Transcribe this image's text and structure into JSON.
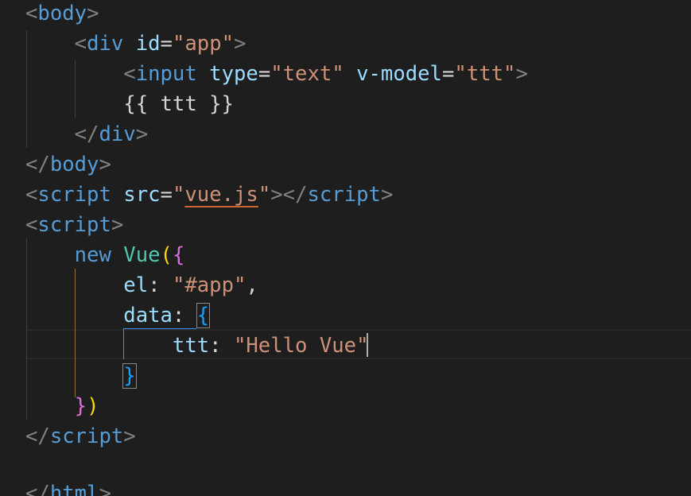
{
  "editor": {
    "language": "html",
    "colors": {
      "background": "#1e1e1e",
      "tag_bracket": "#808080",
      "tag_name": "#569cd6",
      "attribute": "#9cdcfe",
      "string": "#ce9178",
      "text": "#d4d4d4",
      "bracket_level_1": "#ffd700",
      "bracket_level_2": "#da70d6",
      "bracket_level_3": "#179fff"
    },
    "code": {
      "l1": {
        "open": "<",
        "tag": "body",
        "close": ">"
      },
      "l2": {
        "open": "<",
        "tag": "div",
        "attr": "id",
        "eq": "=",
        "val": "\"app\"",
        "close": ">"
      },
      "l3": {
        "open": "<",
        "tag": "input",
        "attr1": "type",
        "eq1": "=",
        "val1": "\"text\"",
        "attr2": "v-model",
        "eq2": "=",
        "val2": "\"ttt\"",
        "close": ">"
      },
      "l4": {
        "text": "{{ ttt }}"
      },
      "l5": {
        "open": "</",
        "tag": "div",
        "close": ">"
      },
      "l6": {
        "open": "</",
        "tag": "body",
        "close": ">"
      },
      "l7": {
        "open": "<",
        "tag": "script",
        "attr": "src",
        "eq": "=",
        "q1": "\"",
        "val": "vue.js",
        "q2": "\"",
        "mid": "></",
        "tag2": "script",
        "close": ">"
      },
      "l8": {
        "open": "<",
        "tag": "script",
        "close": ">"
      },
      "l9": {
        "kw": "new",
        "cls": "Vue",
        "paren": "(",
        "brace": "{"
      },
      "l10": {
        "key": "el",
        "colon": ":",
        "val": "\"#app\"",
        "comma": ","
      },
      "l11": {
        "key": "data",
        "colon": ":",
        "brace": "{"
      },
      "l12": {
        "key": "ttt",
        "colon": ":",
        "val": "\"Hello Vue\""
      },
      "l13": {
        "brace": "}"
      },
      "l14": {
        "brace": "}",
        "paren": ")"
      },
      "l15": {
        "open": "</",
        "tag": "script",
        "close": ">"
      },
      "l16": {
        "text": ""
      },
      "l17": {
        "open": "</",
        "tag": "html",
        "close": ">"
      }
    }
  }
}
